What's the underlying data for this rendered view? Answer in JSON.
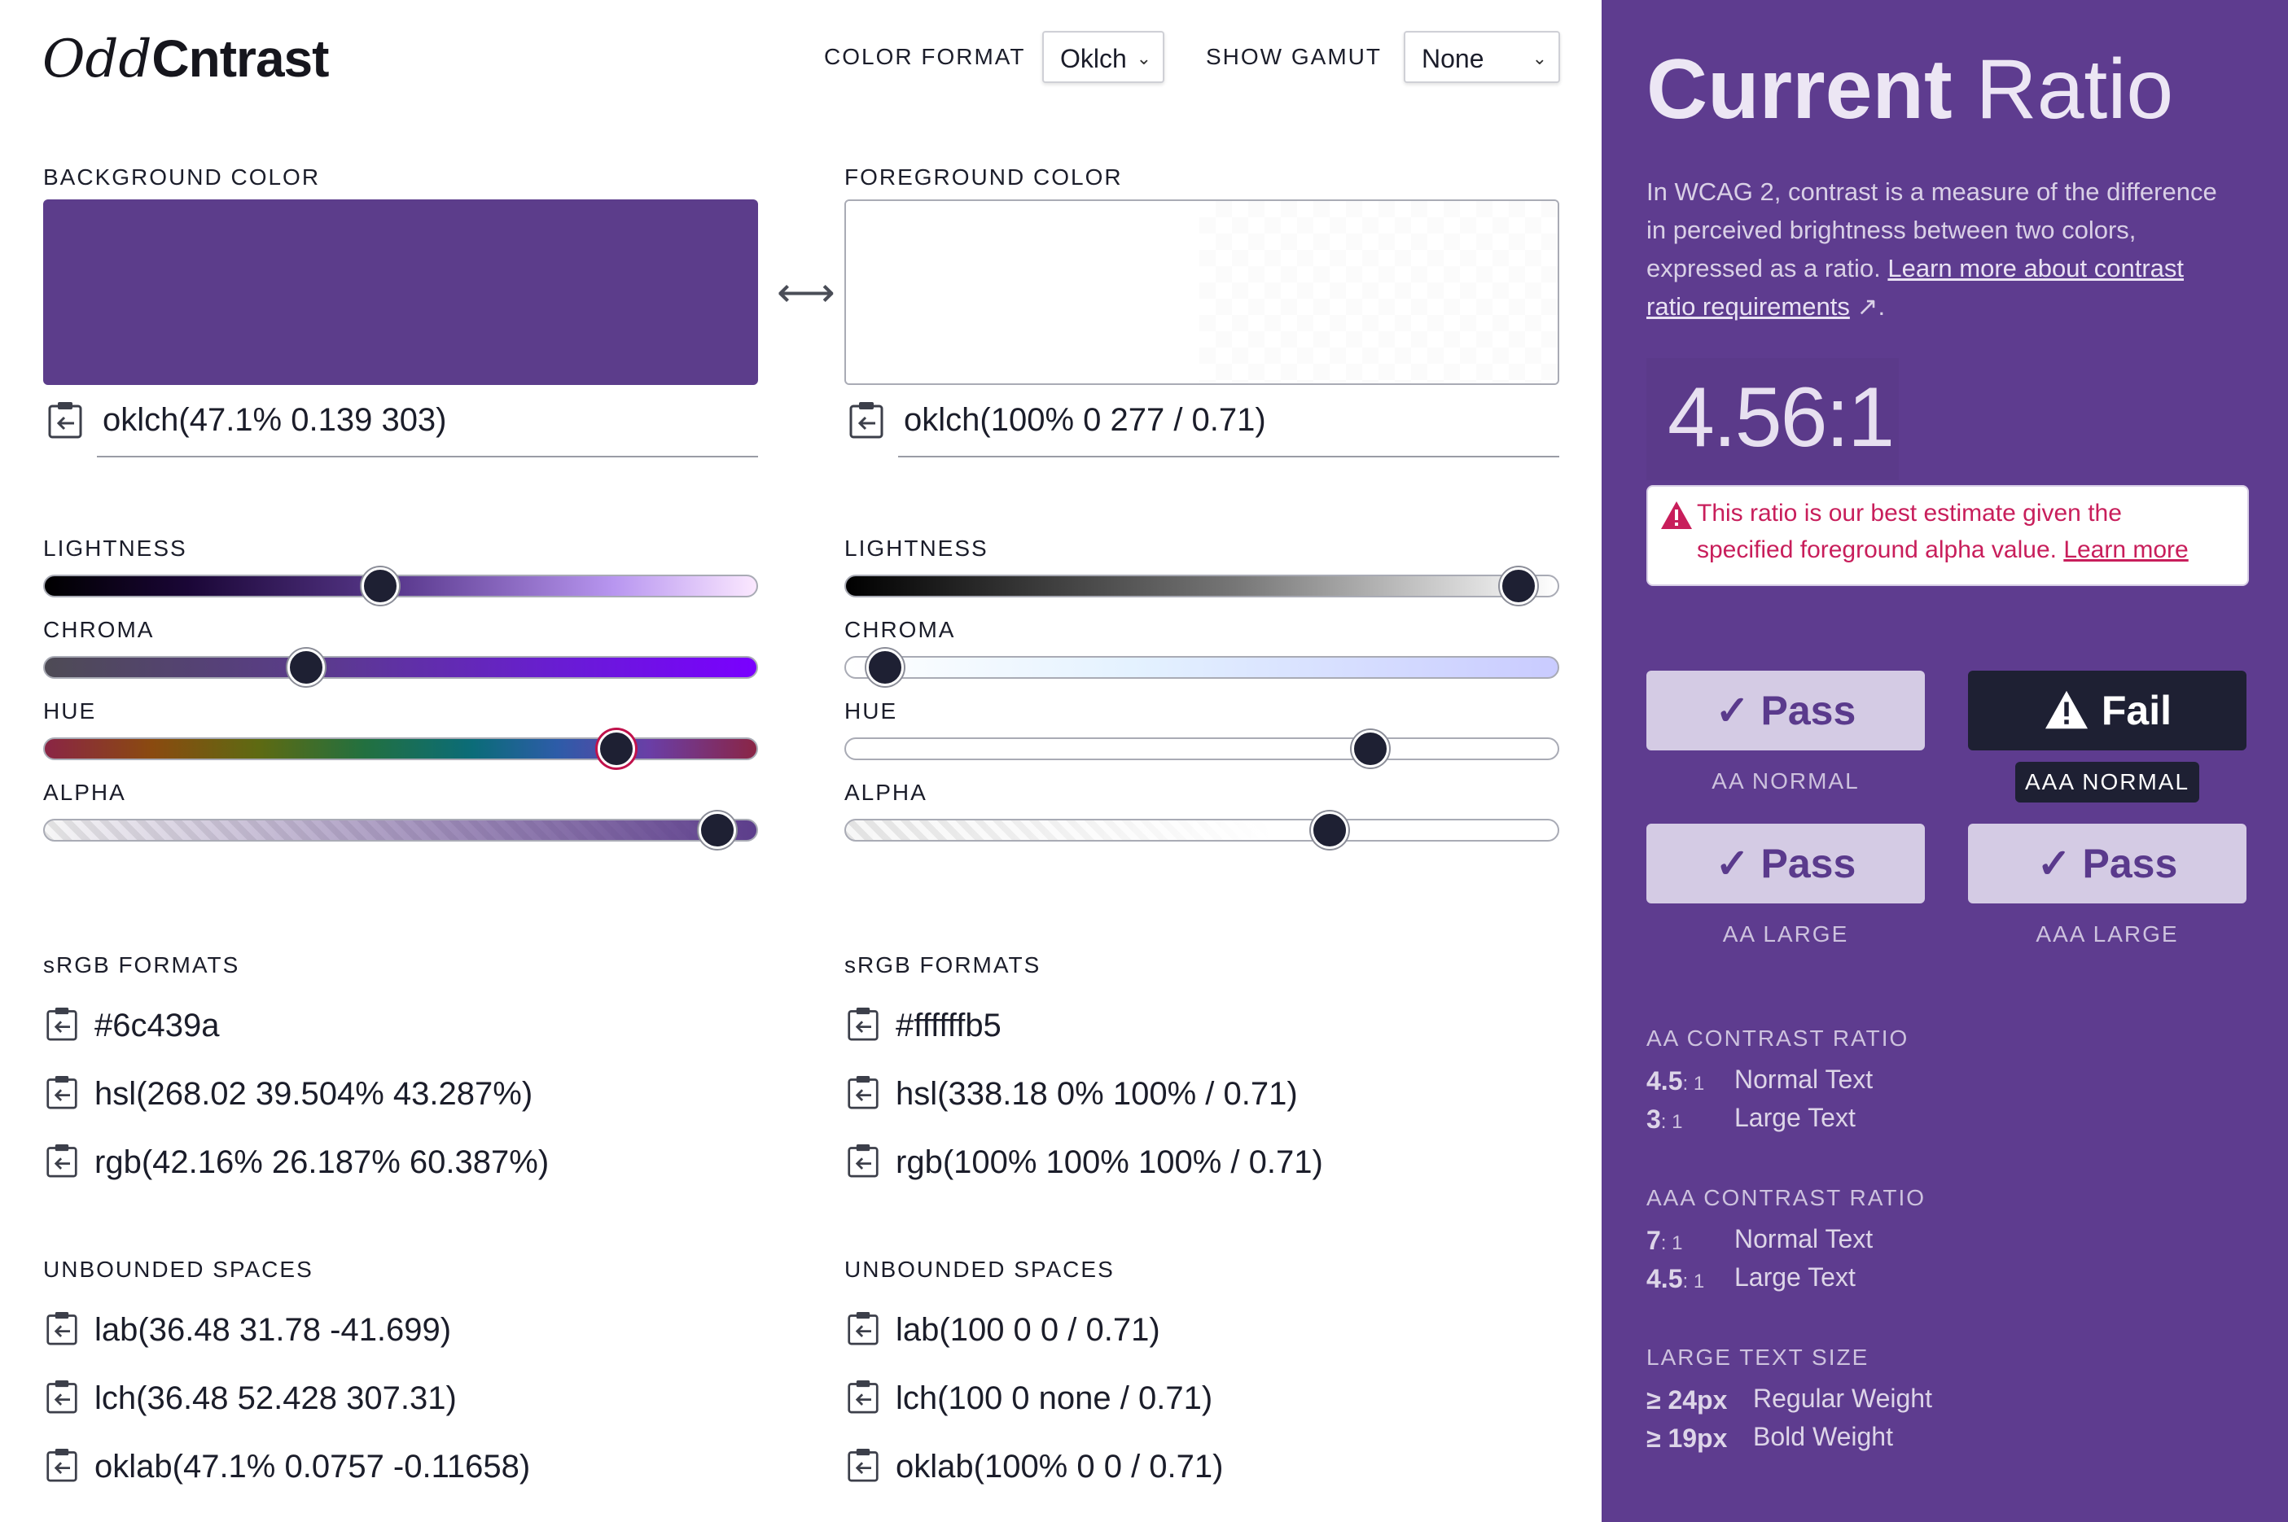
{
  "logo": {
    "part1": "Odd",
    "part2": "ntrast"
  },
  "controls": {
    "color_format_label": "COLOR FORMAT",
    "color_format_value": "Oklch",
    "show_gamut_label": "SHOW GAMUT",
    "show_gamut_value": "None"
  },
  "background": {
    "label": "BACKGROUND COLOR",
    "swatch_color": "#5c3d8b",
    "value": "oklch(47.1% 0.139 303)",
    "sliders": [
      {
        "label": "LIGHTNESS",
        "position": 0.47
      },
      {
        "label": "CHROMA",
        "position": 0.36
      },
      {
        "label": "HUE",
        "position": 0.82
      },
      {
        "label": "ALPHA",
        "position": 0.97
      }
    ],
    "srgb_label": "sRGB FORMATS",
    "srgb": [
      "#6c439a",
      "hsl(268.02 39.504% 43.287%)",
      "rgb(42.16% 26.187% 60.387%)"
    ],
    "unbounded_label": "UNBOUNDED SPACES",
    "unbounded": [
      "lab(36.48 31.78 -41.699)",
      "lch(36.48 52.428 307.31)",
      "oklab(47.1% 0.0757 -0.11658)"
    ]
  },
  "swap_icon": "swap-arrows-icon",
  "foreground": {
    "label": "FOREGROUND COLOR",
    "value": "oklch(100% 0 277 / 0.71)",
    "sliders": [
      {
        "label": "LIGHTNESS",
        "position": 0.97
      },
      {
        "label": "CHROMA",
        "position": 0.03
      },
      {
        "label": "HUE",
        "position": 0.75
      },
      {
        "label": "ALPHA",
        "position": 0.69
      }
    ],
    "srgb_label": "sRGB FORMATS",
    "srgb": [
      "#ffffffb5",
      "hsl(338.18 0% 100% / 0.71)",
      "rgb(100% 100% 100% / 0.71)"
    ],
    "unbounded_label": "UNBOUNDED SPACES",
    "unbounded": [
      "lab(100 0 0 / 0.71)",
      "lch(100 0 none / 0.71)",
      "oklab(100% 0 0 / 0.71)"
    ]
  },
  "panel": {
    "title_bold": "Current",
    "title_light": "Ratio",
    "desc_text": "In WCAG 2, contrast is a measure of the difference in perceived brightness between two colors, expressed as a ratio. ",
    "desc_link": "Learn more about contrast ratio requirements",
    "ratio": "4.56:1",
    "warning_text": "This ratio is our best estimate given the specified foreground alpha value. ",
    "warning_link": "Learn more",
    "results": [
      {
        "status": "Pass",
        "label": "AA NORMAL"
      },
      {
        "status": "Fail",
        "label": "AAA NORMAL"
      },
      {
        "status": "Pass",
        "label": "AA LARGE"
      },
      {
        "status": "Pass",
        "label": "AAA LARGE"
      }
    ],
    "aa_label": "AA CONTRAST RATIO",
    "aa_rows": [
      {
        "k": "4.5",
        "v": "Normal Text"
      },
      {
        "k": "3",
        "v": "Large Text"
      }
    ],
    "aaa_label": "AAA CONTRAST RATIO",
    "aaa_rows": [
      {
        "k": "7",
        "v": "Normal Text"
      },
      {
        "k": "4.5",
        "v": "Large Text"
      }
    ],
    "ratio_suffix": ": 1",
    "large_label": "LARGE TEXT SIZE",
    "large_rows": [
      {
        "k": "≥ 24px",
        "v": "Regular Weight"
      },
      {
        "k": "≥ 19px",
        "v": "Bold Weight"
      }
    ]
  },
  "colors": {
    "panel_bg": "#5e3c8f",
    "accent": "#5a3a8c",
    "warning": "#c81e5b",
    "thumb": "#1e2033"
  }
}
